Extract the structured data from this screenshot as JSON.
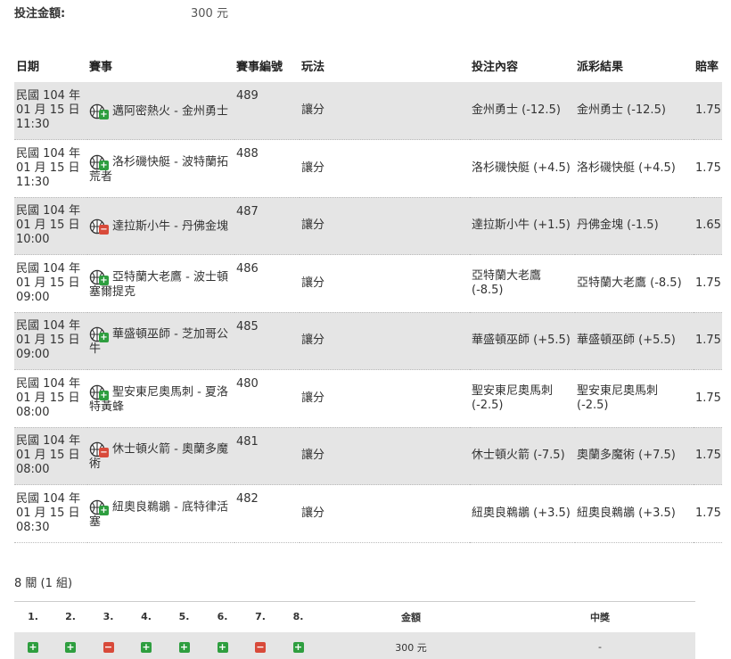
{
  "bet_amount": {
    "label": "投注金額:",
    "value": "300 元"
  },
  "headers": {
    "date": "日期",
    "event": "賽事",
    "event_no": "賽事編號",
    "play_type": "玩法",
    "bet_content": "投注內容",
    "result": "派彩結果",
    "odds": "賠率"
  },
  "rows": [
    {
      "date": "民國 104 年 01 月 15 日 11:30",
      "event": "邁阿密熱火 - 金州勇士",
      "no": "489",
      "play": "讓分",
      "bet": "金州勇士 (-12.5)",
      "result": "金州勇士 (-12.5)",
      "odds": "1.75",
      "status": "plus"
    },
    {
      "date": "民國 104 年 01 月 15 日 11:30",
      "event": "洛杉磯快艇 - 波特蘭拓荒者",
      "no": "488",
      "play": "讓分",
      "bet": "洛杉磯快艇 (+4.5)",
      "result": "洛杉磯快艇 (+4.5)",
      "odds": "1.75",
      "status": "plus"
    },
    {
      "date": "民國 104 年 01 月 15 日 10:00",
      "event": "達拉斯小牛 - 丹佛金塊",
      "no": "487",
      "play": "讓分",
      "bet": "達拉斯小牛 (+1.5)",
      "result": "丹佛金塊 (-1.5)",
      "odds": "1.65",
      "status": "minus"
    },
    {
      "date": "民國 104 年 01 月 15 日 09:00",
      "event": "亞特蘭大老鷹 - 波士頓塞爾提克",
      "no": "486",
      "play": "讓分",
      "bet": "亞特蘭大老鷹 (-8.5)",
      "result": "亞特蘭大老鷹 (-8.5)",
      "odds": "1.75",
      "status": "plus"
    },
    {
      "date": "民國 104 年 01 月 15 日 09:00",
      "event": "華盛頓巫師 - 芝加哥公牛",
      "no": "485",
      "play": "讓分",
      "bet": "華盛頓巫師 (+5.5)",
      "result": "華盛頓巫師 (+5.5)",
      "odds": "1.75",
      "status": "plus"
    },
    {
      "date": "民國 104 年 01 月 15 日 08:00",
      "event": "聖安東尼奧馬刺 - 夏洛特黃蜂",
      "no": "480",
      "play": "讓分",
      "bet": "聖安東尼奧馬刺 (-2.5)",
      "result": "聖安東尼奧馬刺 (-2.5)",
      "odds": "1.75",
      "status": "plus"
    },
    {
      "date": "民國 104 年 01 月 15 日 08:00",
      "event": "休士頓火箭 - 奧蘭多魔術",
      "no": "481",
      "play": "讓分",
      "bet": "休士頓火箭 (-7.5)",
      "result": "奧蘭多魔術 (+7.5)",
      "odds": "1.75",
      "status": "minus"
    },
    {
      "date": "民國 104 年 01 月 15 日 08:30",
      "event": "紐奧良鵜鶘 - 底特律活塞",
      "no": "482",
      "play": "讓分",
      "bet": "紐奧良鵜鶘 (+3.5)",
      "result": "紐奧良鵜鶘 (+3.5)",
      "odds": "1.75",
      "status": "plus"
    }
  ],
  "parlay_info": "8 關 (1 組)",
  "summary": {
    "headers": [
      "1.",
      "2.",
      "3.",
      "4.",
      "5.",
      "6.",
      "7.",
      "8."
    ],
    "amount_header": "金額",
    "win_header": "中獎",
    "statuses": [
      "plus",
      "plus",
      "minus",
      "plus",
      "plus",
      "plus",
      "minus",
      "plus"
    ],
    "amount": "300 元",
    "win": "-"
  },
  "colors": {
    "win": "#2e9e3f",
    "loss": "#d84a3a",
    "row_alt": "#e5e5e5"
  }
}
